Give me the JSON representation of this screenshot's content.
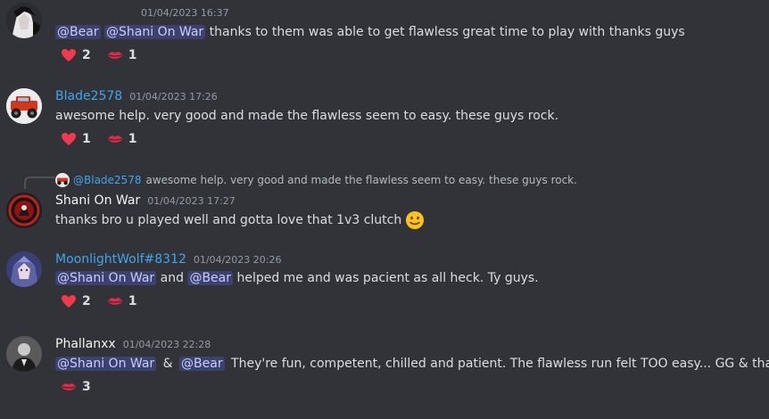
{
  "messages": [
    {
      "username": "",
      "timestamp": "01/04/2023 16:37",
      "mentions": [
        "@Bear",
        "@Shani On War"
      ],
      "text": "thanks to them was able to get flawless great time to play with thanks guys",
      "reactions": [
        {
          "icon": "heart-icon",
          "count": "2"
        },
        {
          "icon": "lips-icon",
          "count": "1"
        }
      ]
    },
    {
      "username": "Blade2578",
      "name_color": "#3ea6f0",
      "timestamp": "01/04/2023 17:26",
      "text": "awesome help. very good and made the flawless seem to easy. these guys rock.",
      "reactions": [
        {
          "icon": "heart-icon",
          "count": "1"
        },
        {
          "icon": "lips-icon",
          "count": "1"
        }
      ]
    },
    {
      "reply": {
        "mention": "@Blade2578",
        "text": "awesome help. very good and made the flawless seem to easy. these guys rock."
      },
      "username": "Shani On War",
      "name_color": "#f2f3f5",
      "timestamp": "01/04/2023 17:27",
      "text": "thanks bro u played well and gotta love that 1v3 clutch",
      "emoji": "slightly-smiling-face-icon"
    },
    {
      "username": "MoonlightWolf#8312",
      "name_color": "#3ea6f0",
      "timestamp": "01/04/2023 20:26",
      "mention1": "@Shani On War",
      "joiner": "and",
      "mention2": "@Bear",
      "text": "helped me and was pacient as all heck. Ty guys.",
      "reactions": [
        {
          "icon": "heart-icon",
          "count": "2"
        },
        {
          "icon": "lips-icon",
          "count": "1"
        }
      ]
    },
    {
      "username": "Phallanxx",
      "name_color": "#f2f3f5",
      "timestamp": "01/04/2023 22:28",
      "mention1": "@Shani On War",
      "joiner": "&",
      "mention2": "@Bear",
      "text": "They're fun, competent, chilled and patient. The flawless run felt TOO easy... GG & thanks.",
      "reactions": [
        {
          "icon": "lips-icon",
          "count": "3"
        }
      ]
    }
  ]
}
